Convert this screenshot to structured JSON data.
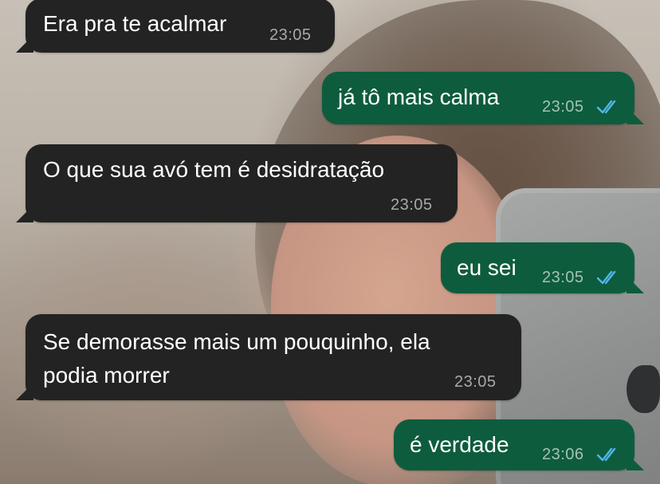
{
  "colors": {
    "incoming_bubble": "#232323",
    "outgoing_bubble": "#0e5c3e",
    "read_ticks": "#4fb6ec"
  },
  "messages": [
    {
      "direction": "incoming",
      "text": "Era pra te acalmar",
      "time": "23:05"
    },
    {
      "direction": "outgoing",
      "text": "já tô mais calma",
      "time": "23:05",
      "status_icon": "double-check-read"
    },
    {
      "direction": "incoming",
      "text": "O que sua avó tem é desidratação",
      "time": "23:05"
    },
    {
      "direction": "outgoing",
      "text": "eu sei",
      "time": "23:05",
      "status_icon": "double-check-read"
    },
    {
      "direction": "incoming",
      "text": "Se demorasse mais um pouquinho, ela\npodia morrer",
      "time": "23:05"
    },
    {
      "direction": "outgoing",
      "text": "é verdade",
      "time": "23:06",
      "status_icon": "double-check-read"
    }
  ]
}
